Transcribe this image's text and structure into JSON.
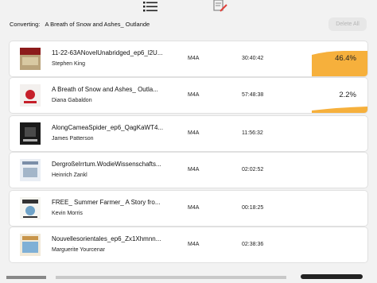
{
  "toolbar": {
    "icons": [
      "list-icon",
      "edit-icon"
    ]
  },
  "status": {
    "converting_label": "Converting:",
    "converting_title": "A Breath of Snow and Ashes_ Outlande"
  },
  "actions": {
    "delete_all": "Delete All"
  },
  "colors": {
    "accent": "#f6b03c",
    "background": "#f2f2f2"
  },
  "items": [
    {
      "title": "11-22-63ANovelUnabridged_ep6_l2U...",
      "author": "Stephen King",
      "format": "M4A",
      "duration": "30:40:42",
      "progress_label": "46.4%",
      "progress": 0.464
    },
    {
      "title": "A Breath of Snow and Ashes_ Outla...",
      "author": "Diana Gabaldon",
      "format": "M4A",
      "duration": "57:48:38",
      "progress_label": "2.2%",
      "progress": 0.022
    },
    {
      "title": "AlongCameaSpider_ep6_QagKaWT4...",
      "author": "James Patterson",
      "format": "M4A",
      "duration": "11:56:32"
    },
    {
      "title": "DergroßeIrrtum.WodieWissenschafts...",
      "author": "Heinrich Zankl",
      "format": "M4A",
      "duration": "02:02:52"
    },
    {
      "title": "FREE_ Summer Farmer_ A Story fro...",
      "author": "Kevin Morris",
      "format": "M4A",
      "duration": "00:18:25"
    },
    {
      "title": "Nouvellesorientales_ep6_Zx1Xhmnn...",
      "author": "Marguerite Yourcenar",
      "format": "M4A",
      "duration": "02:38:36"
    }
  ]
}
